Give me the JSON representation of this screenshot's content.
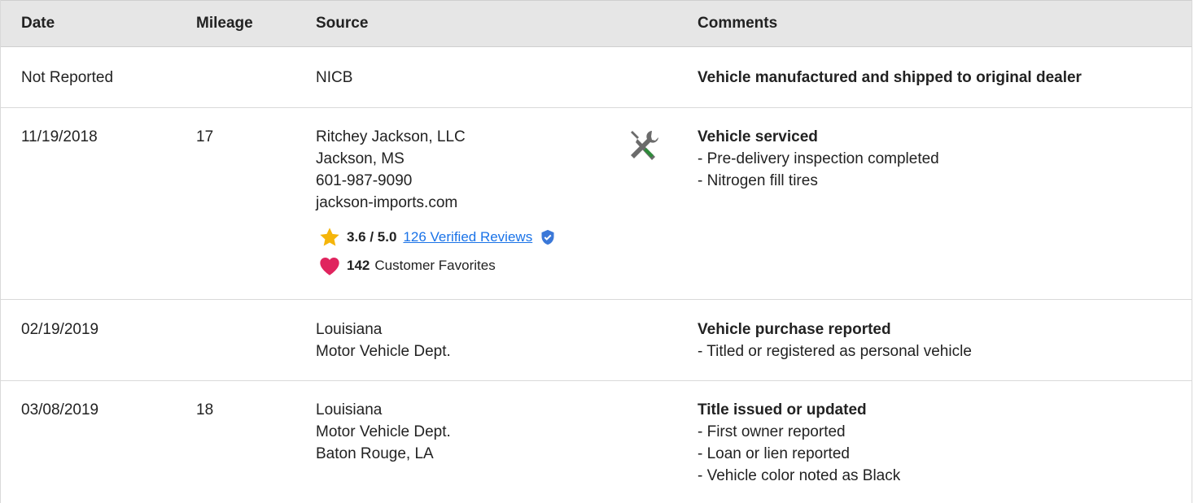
{
  "header": {
    "date": "Date",
    "mileage": "Mileage",
    "source": "Source",
    "comments": "Comments"
  },
  "rows": [
    {
      "date": "Not Reported",
      "mileage": "",
      "source": [
        "NICB"
      ],
      "comment_title": "Vehicle manufactured and shipped to original dealer",
      "comment_items": []
    },
    {
      "date": "11/19/2018",
      "mileage": "17",
      "source": [
        "Ritchey Jackson, LLC",
        "Jackson, MS",
        "601-987-9090",
        "jackson-imports.com"
      ],
      "rating": "3.6 / 5.0",
      "reviews_link": "126 Verified Reviews",
      "favorites_count": "142",
      "favorites_label": "Customer Favorites",
      "service_icon": "wrench-screwdriver-icon",
      "comment_title": "Vehicle serviced",
      "comment_items": [
        "- Pre-delivery inspection completed",
        "- Nitrogen fill tires"
      ]
    },
    {
      "date": "02/19/2019",
      "mileage": "",
      "source": [
        "Louisiana",
        "Motor Vehicle Dept."
      ],
      "comment_title": "Vehicle purchase reported",
      "comment_items": [
        "- Titled or registered as personal vehicle"
      ]
    },
    {
      "date": "03/08/2019",
      "mileage": "18",
      "source": [
        "Louisiana",
        "Motor Vehicle Dept.",
        "Baton Rouge, LA"
      ],
      "comment_title": "Title issued or updated",
      "comment_items": [
        "- First owner reported",
        "- Loan or lien reported",
        "- Vehicle color noted as Black"
      ]
    }
  ],
  "colors": {
    "header_bg": "#e6e6e6",
    "link": "#1a73e8",
    "star": "#f5b50a",
    "heart": "#e0245e",
    "shield": "#3b78d8",
    "wrench_green": "#2e8b3a"
  }
}
